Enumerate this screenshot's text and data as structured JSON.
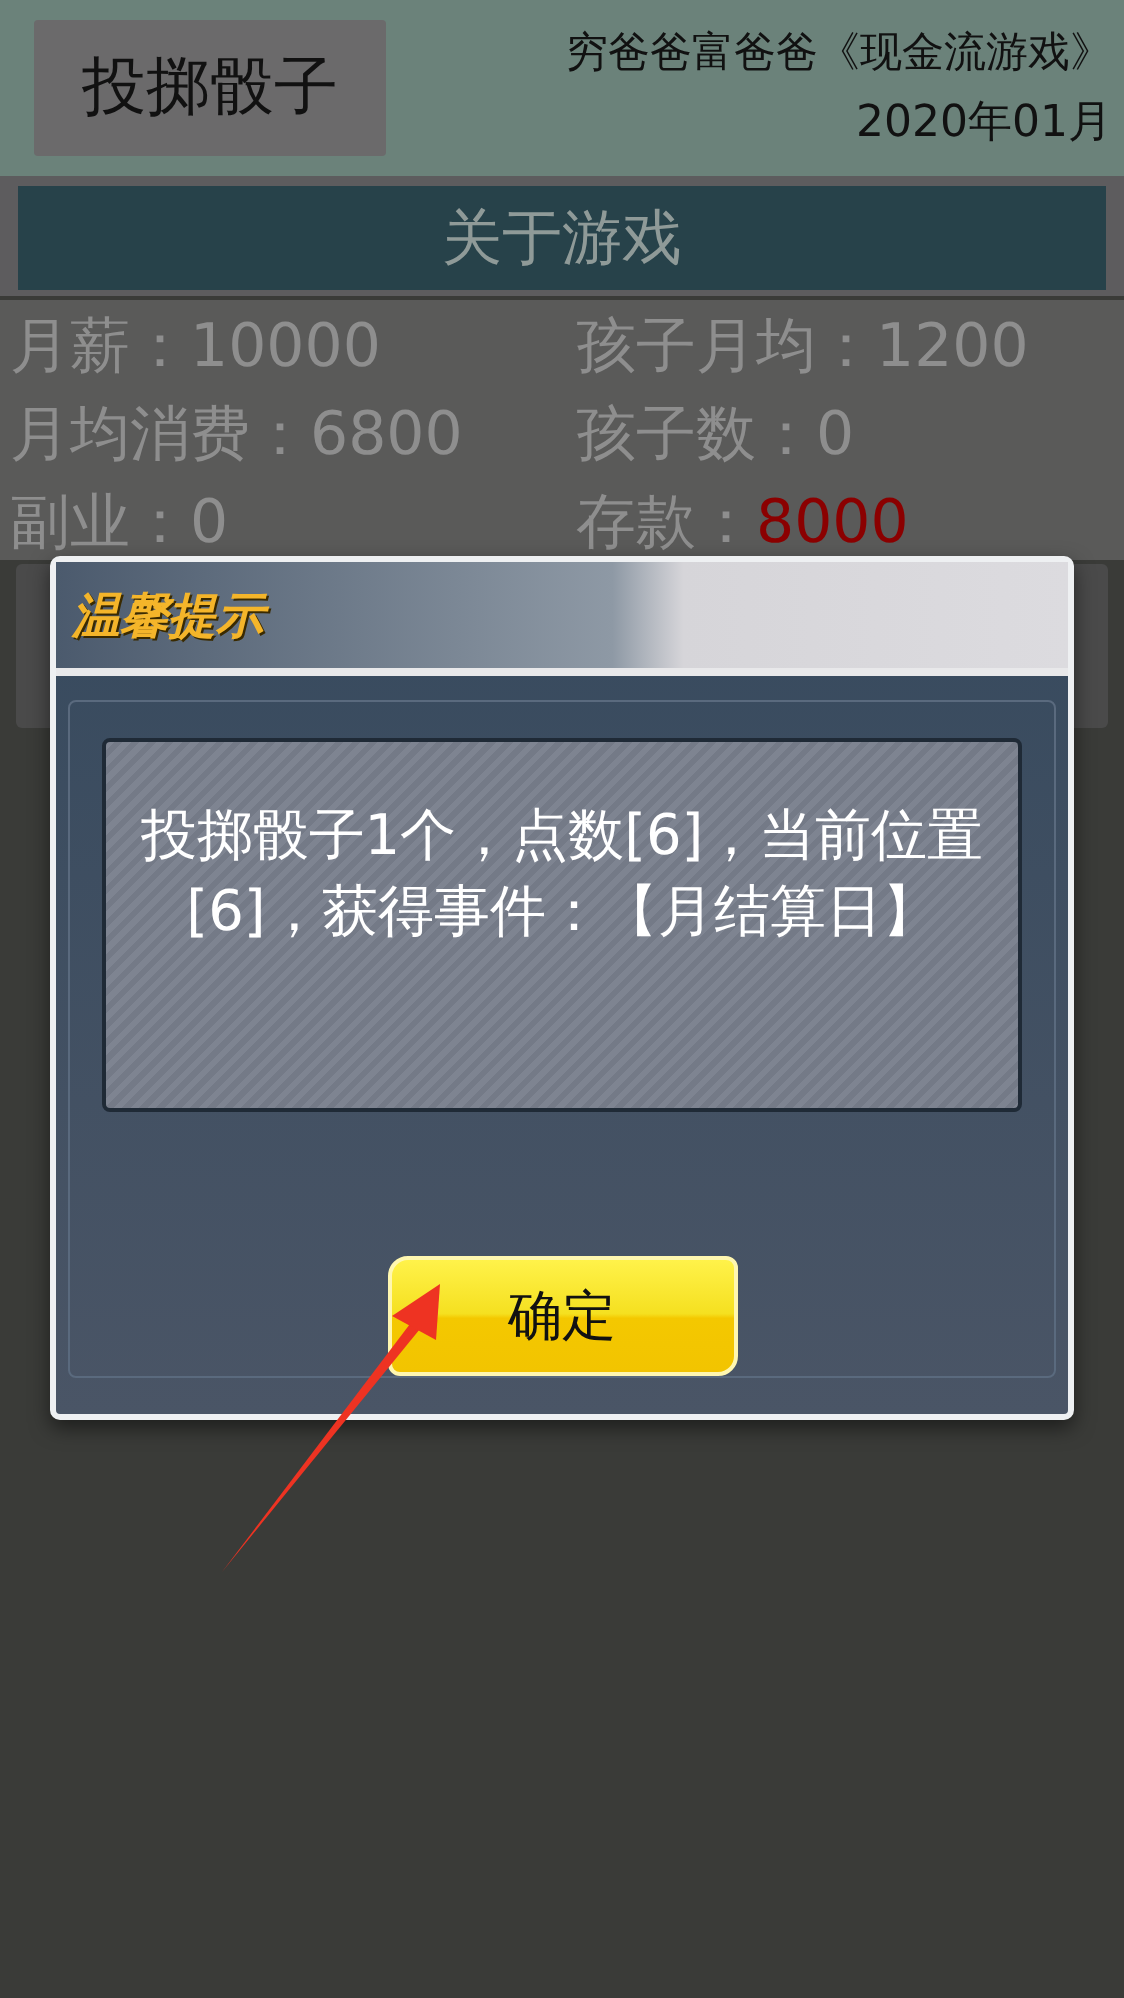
{
  "header": {
    "roll_button": "投掷骰子",
    "title": "穷爸爸富爸爸《现金流游戏》",
    "date": "2020年01月"
  },
  "about_button": "关于游戏",
  "stats": [
    {
      "label": "月薪：",
      "value": "10000",
      "color": "#8e8e8e"
    },
    {
      "label": "孩子月均：",
      "value": "1200",
      "color": "#8e8e8e"
    },
    {
      "label": "月均消费：",
      "value": "6800",
      "color": "#8e8e8e"
    },
    {
      "label": "孩子数：",
      "value": "0",
      "color": "#8e8e8e"
    },
    {
      "label": "副业：",
      "value": "0",
      "color": "#8e8e8e"
    },
    {
      "label": "存款：",
      "value": "8000",
      "color": "#8b0000"
    }
  ],
  "dialog": {
    "title": "温馨提示",
    "message": "投掷骰子1个，点数[6]，当前位置[6]，获得事件：【月结算日】",
    "confirm_button": "确定"
  }
}
